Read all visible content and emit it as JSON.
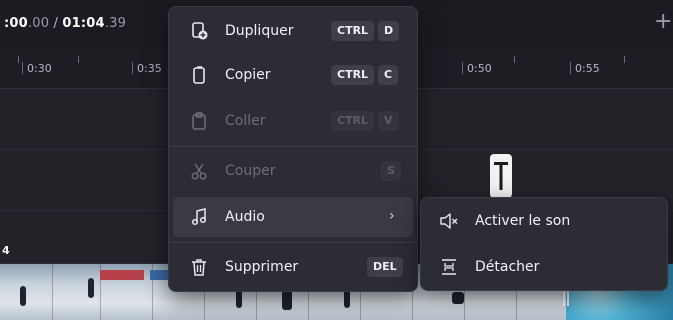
{
  "timecode": {
    "current_main": ":00",
    "current_frac": ".00",
    "separator": " / ",
    "total_main": "01:04",
    "total_frac": ".39"
  },
  "ruler": {
    "ticks": [
      "0:30",
      "0:35",
      "0:50",
      "0:55"
    ]
  },
  "track_number": "4",
  "context_menu": {
    "items": [
      {
        "label": "Dupliquer",
        "icon": "duplicate-icon",
        "shortcut": [
          "CTRL",
          "D"
        ],
        "enabled": true
      },
      {
        "label": "Copier",
        "icon": "copy-icon",
        "shortcut": [
          "CTRL",
          "C"
        ],
        "enabled": true
      },
      {
        "label": "Coller",
        "icon": "paste-icon",
        "shortcut": [
          "CTRL",
          "V"
        ],
        "enabled": false
      },
      {
        "label": "Couper",
        "icon": "scissors-icon",
        "shortcut": [
          "S"
        ],
        "enabled": false
      },
      {
        "label": "Audio",
        "icon": "music-note-icon",
        "submenu": true,
        "enabled": true
      },
      {
        "label": "Supprimer",
        "icon": "trash-icon",
        "shortcut": [
          "DEL"
        ],
        "enabled": true
      }
    ]
  },
  "audio_submenu": {
    "items": [
      {
        "label": "Activer le son",
        "icon": "speaker-muted-icon"
      },
      {
        "label": "Détacher",
        "icon": "detach-icon"
      }
    ]
  },
  "colors": {
    "menu_bg": "#2c2c34",
    "highlight": "#3a3a44",
    "timeline_bg": "#23232b"
  }
}
